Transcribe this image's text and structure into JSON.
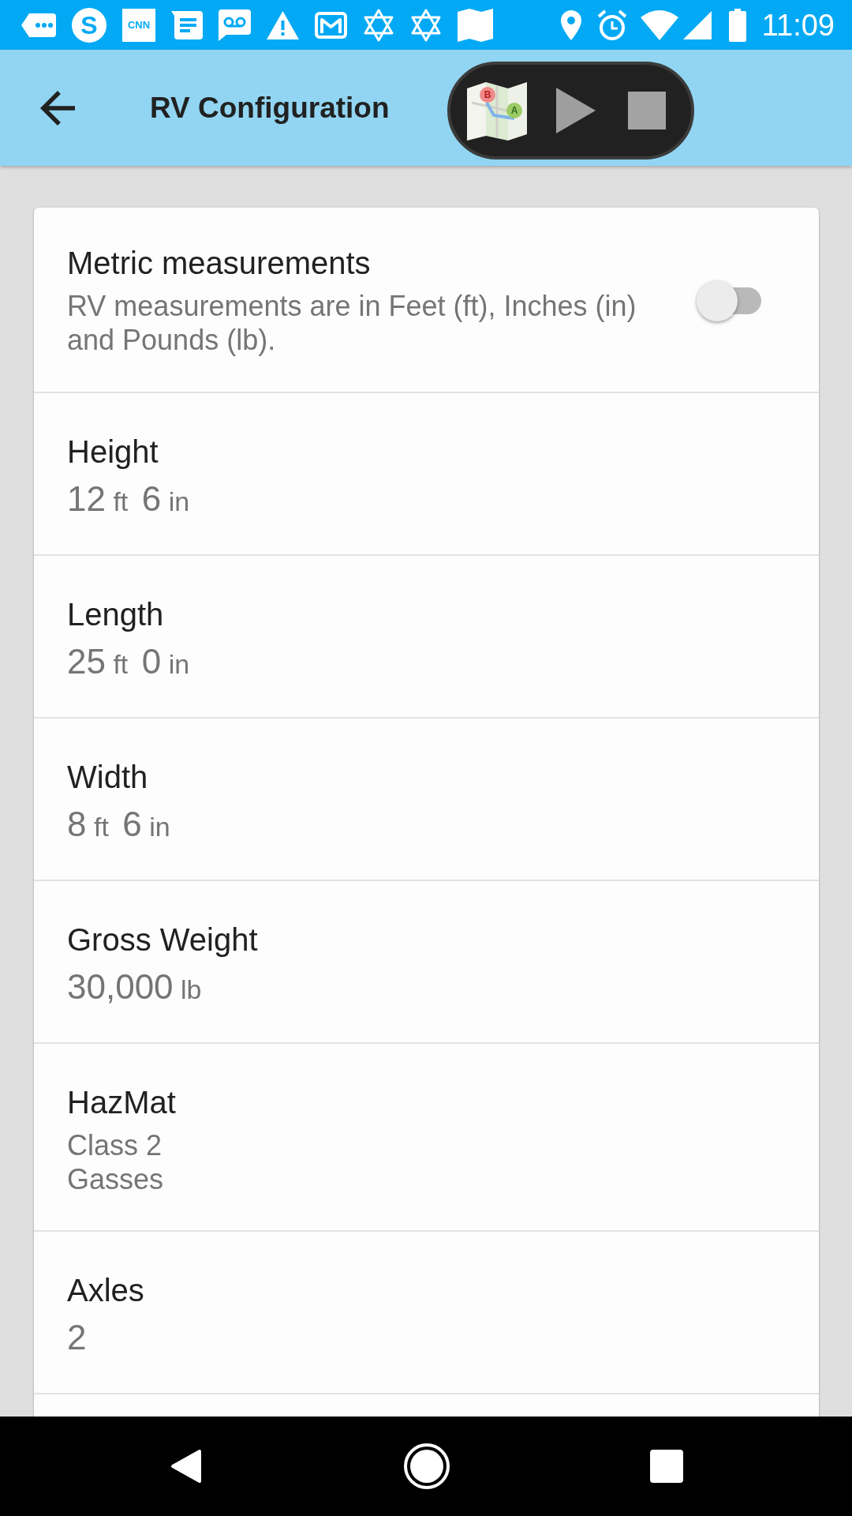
{
  "status_bar": {
    "letter_badge": "S",
    "text_badge": "CNN",
    "time": "11:09"
  },
  "toolbar": {
    "title": "RV Configuration"
  },
  "overlay": {
    "pin_labels": [
      "B",
      "A"
    ]
  },
  "settings": [
    {
      "kind": "toggle",
      "title": "Metric measurements",
      "description": "RV measurements are in Feet (ft), Inches (in) and Pounds (lb).",
      "on": false
    },
    {
      "kind": "measure",
      "title": "Height",
      "parts": [
        {
          "number": "12",
          "unit": "ft"
        },
        {
          "number": "6",
          "unit": "in"
        }
      ]
    },
    {
      "kind": "measure",
      "title": "Length",
      "parts": [
        {
          "number": "25",
          "unit": "ft"
        },
        {
          "number": "0",
          "unit": "in"
        }
      ]
    },
    {
      "kind": "measure",
      "title": "Width",
      "parts": [
        {
          "number": "8",
          "unit": "ft"
        },
        {
          "number": "6",
          "unit": "in"
        }
      ]
    },
    {
      "kind": "measure",
      "title": "Gross Weight",
      "parts": [
        {
          "number": "30,000",
          "unit": "lb"
        }
      ]
    },
    {
      "kind": "lines",
      "title": "HazMat",
      "lines": [
        "Class 2",
        "Gasses"
      ]
    },
    {
      "kind": "measure",
      "title": "Axles",
      "parts": [
        {
          "number": "2"
        }
      ]
    }
  ]
}
